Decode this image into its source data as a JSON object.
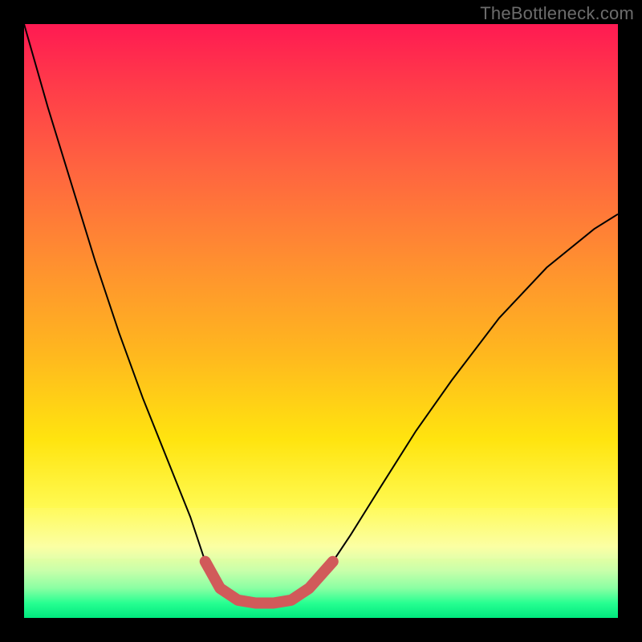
{
  "watermark": "TheBottleneck.com",
  "chart_data": {
    "type": "line",
    "title": "",
    "xlabel": "",
    "ylabel": "",
    "xlim": [
      0,
      1
    ],
    "ylim": [
      0,
      1
    ],
    "background_gradient": {
      "top": "#ff1a52",
      "mid": "#ffe40f",
      "bottom": "#00e87e"
    },
    "series": [
      {
        "name": "bottleneck-curve",
        "color": "#000000",
        "width": 2,
        "x": [
          0.0,
          0.04,
          0.08,
          0.12,
          0.16,
          0.2,
          0.24,
          0.28,
          0.305,
          0.33,
          0.36,
          0.39,
          0.42,
          0.45,
          0.48,
          0.52,
          0.55,
          0.6,
          0.66,
          0.72,
          0.8,
          0.88,
          0.96,
          1.0
        ],
        "y": [
          1.0,
          0.86,
          0.73,
          0.6,
          0.48,
          0.37,
          0.27,
          0.17,
          0.095,
          0.05,
          0.03,
          0.025,
          0.025,
          0.03,
          0.05,
          0.095,
          0.14,
          0.22,
          0.315,
          0.4,
          0.505,
          0.59,
          0.655,
          0.68
        ]
      },
      {
        "name": "highlight-trough",
        "color": "#d15a5a",
        "width": 14,
        "linecap": "round",
        "x": [
          0.305,
          0.33,
          0.36,
          0.39,
          0.42,
          0.45,
          0.48,
          0.52
        ],
        "y": [
          0.095,
          0.05,
          0.03,
          0.025,
          0.025,
          0.03,
          0.05,
          0.095
        ]
      }
    ]
  }
}
